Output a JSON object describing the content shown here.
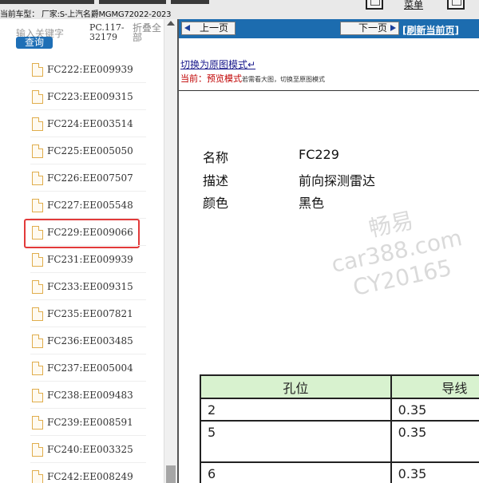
{
  "topbar": {
    "vehicle_info": "当前车型：  厂家:S-上汽名爵MGMG72022-2023",
    "menu_label": "菜单"
  },
  "sidebar": {
    "keyword_label": "输入关键字",
    "search_button": "查询",
    "pc_code": "PC.117-32179",
    "collapse_all": "折叠全部",
    "items": [
      {
        "label": "FC222:EE009939"
      },
      {
        "label": "FC223:EE009315"
      },
      {
        "label": "FC224:EE003514"
      },
      {
        "label": "FC225:EE005050"
      },
      {
        "label": "FC226:EE007507"
      },
      {
        "label": "FC227:EE005548"
      },
      {
        "label": "FC229:EE009066"
      },
      {
        "label": "FC231:EE009939"
      },
      {
        "label": "FC233:EE009315"
      },
      {
        "label": "FC235:EE007821"
      },
      {
        "label": "FC236:EE003485"
      },
      {
        "label": "FC237:EE005004"
      },
      {
        "label": "FC238:EE009483"
      },
      {
        "label": "FC239:EE008591"
      },
      {
        "label": "FC240:EE003325"
      },
      {
        "label": "FC242:EE008249"
      }
    ],
    "selected_index": 6
  },
  "navbar": {
    "prev_label": "上一页",
    "next_label": "下一页",
    "refresh_label": "[刷新当前页]"
  },
  "mode": {
    "switch_link": "切换为原图模式↵",
    "current_label": "当前：",
    "current_mode": "预览模式",
    "hint": "若需看大图，切换至原图模式"
  },
  "info": {
    "name_key": "名称",
    "name_value": "FC229",
    "desc_key": "描述",
    "desc_value": "前向探测雷达",
    "color_key": "颜色",
    "color_value": "黑色"
  },
  "watermark": {
    "line1": "畅易",
    "line2": "car388.com",
    "line3": "CY20165"
  },
  "pin_table": {
    "headers": [
      "孔位",
      "导线"
    ],
    "rows": [
      [
        "2",
        "0.35"
      ],
      [
        "5",
        "0.35"
      ],
      [
        "6",
        "0.35"
      ]
    ]
  },
  "colors": {
    "nav_blue": "#1c6caf",
    "search_blue": "#1e6fb6",
    "selection_red": "#e23a3a",
    "table_header_green": "#d8f2cf",
    "current_mode_red": "#c00000"
  }
}
